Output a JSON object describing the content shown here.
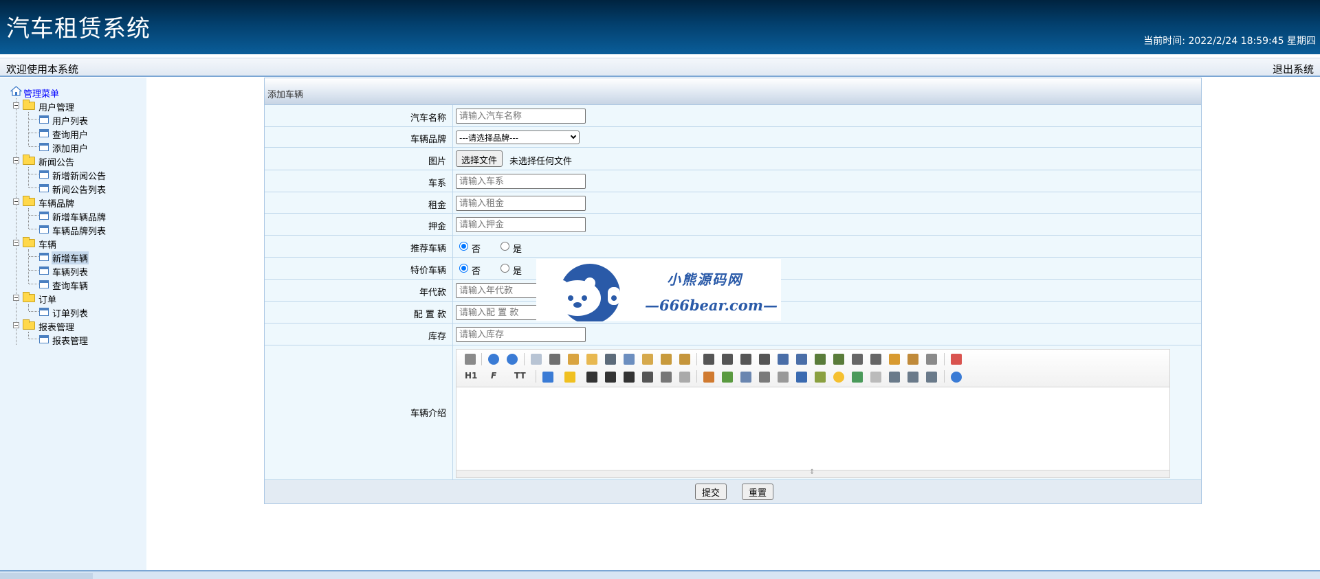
{
  "header": {
    "app_title": "汽车租赁系统",
    "clock_label": "当前时间:",
    "clock_value": "2022/2/24 18:59:45 星期四"
  },
  "welcome_bar": {
    "welcome_text": "欢迎使用本系统",
    "logout_label": "退出系统"
  },
  "sidebar": {
    "root_label": "管理菜单",
    "groups": [
      {
        "label": "用户管理",
        "items": [
          "用户列表",
          "查询用户",
          "添加用户"
        ]
      },
      {
        "label": "新闻公告",
        "items": [
          "新增新闻公告",
          "新闻公告列表"
        ]
      },
      {
        "label": "车辆品牌",
        "items": [
          "新增车辆品牌",
          "车辆品牌列表"
        ]
      },
      {
        "label": "车辆",
        "items": [
          "新增车辆",
          "车辆列表",
          "查询车辆"
        ]
      },
      {
        "label": "订单",
        "items": [
          "订单列表"
        ]
      },
      {
        "label": "报表管理",
        "items": [
          "报表管理"
        ]
      }
    ],
    "selected_item": "新增车辆"
  },
  "form": {
    "title": "添加车辆",
    "fields": {
      "car_name": {
        "label": "汽车名称",
        "placeholder": "请输入汽车名称"
      },
      "brand": {
        "label": "车辆品牌",
        "selected": "---请选择品牌---"
      },
      "image": {
        "label": "图片",
        "button": "选择文件",
        "status": "未选择任何文件"
      },
      "series": {
        "label": "车系",
        "placeholder": "请输入车系"
      },
      "rent": {
        "label": "租金",
        "placeholder": "请输入租金"
      },
      "deposit": {
        "label": "押金",
        "placeholder": "请输入押金"
      },
      "recommended": {
        "label": "推荐车辆",
        "options": [
          "否",
          "是"
        ],
        "selected": "否"
      },
      "special_price": {
        "label": "特价车辆",
        "options": [
          "否",
          "是"
        ],
        "selected": "否"
      },
      "model_year": {
        "label": "年代款",
        "placeholder": "请输入年代款"
      },
      "config": {
        "label": "配 置 款",
        "placeholder": "请输入配 置 款"
      },
      "stock": {
        "label": "库存",
        "placeholder": "请输入库存"
      },
      "intro": {
        "label": "车辆介绍"
      }
    },
    "editor_toolbar": {
      "heading_label": "H1",
      "font_label": "F",
      "size_label": "TT"
    },
    "submit_label": "提交",
    "reset_label": "重置"
  },
  "watermark": {
    "line1": "小熊源码网",
    "line2": "—666bear.com—"
  },
  "colors": {
    "header_top": "#00233f",
    "header_bottom": "#0a5d99",
    "sidebar_bg": "#eaf4fc",
    "form_bg": "#eef8fd",
    "link_blue": "#0000ff",
    "radio_blue": "#0075ff"
  }
}
